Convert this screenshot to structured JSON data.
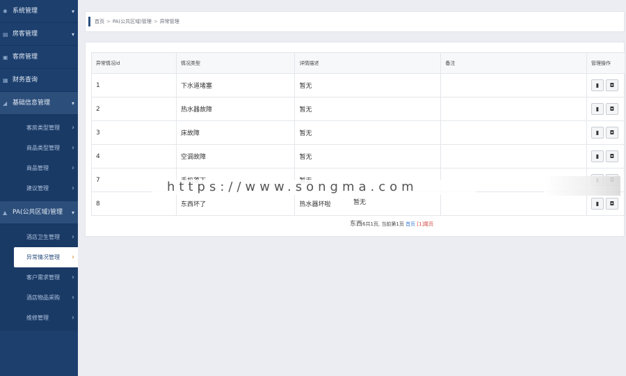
{
  "sidebar": {
    "items": [
      {
        "label": "系统管理",
        "icon": "gear-icon",
        "open": false
      },
      {
        "label": "房客管理",
        "icon": "users-icon",
        "open": false
      },
      {
        "label": "客房管理",
        "icon": "bed-icon",
        "open": false
      },
      {
        "label": "财务查询",
        "icon": "money-icon",
        "open": false
      },
      {
        "label": "基础信息管理",
        "icon": "info-icon",
        "open": true
      }
    ],
    "basic_sub": [
      "客房类型管理",
      "商品类型管理",
      "商品管理",
      "建议管理"
    ],
    "pa_item": {
      "label": "PA(公共区域)管理",
      "icon": "area-icon"
    },
    "pa_sub": [
      "酒店卫生管理",
      "异常情况管理",
      "客户需求管理",
      "酒店物品采购",
      "维修管理"
    ],
    "active_sub": "异常情况管理"
  },
  "breadcrumb": [
    "首页",
    "PA(公共区域)管理",
    "异常管理"
  ],
  "table": {
    "headers": [
      "异常情况id",
      "情况类型",
      "详情描述",
      "备注",
      "管理操作"
    ],
    "rows": [
      {
        "id": "1",
        "type": "下水道堵塞",
        "desc": "暂无",
        "note": ""
      },
      {
        "id": "2",
        "type": "热水器故障",
        "desc": "暂无",
        "note": ""
      },
      {
        "id": "3",
        "type": "床故障",
        "desc": "暂无",
        "note": ""
      },
      {
        "id": "4",
        "type": "空调故障",
        "desc": "暂无",
        "note": ""
      },
      {
        "id": "7",
        "type": "手机落下",
        "desc": "暂无",
        "note": ""
      },
      {
        "id": "8",
        "type": "东西坏了",
        "desc": "热水器坏啦",
        "note": ""
      }
    ],
    "row_ops": [
      "trash-icon",
      "bell-icon"
    ]
  },
  "pager": {
    "big": "东西",
    "summary": "6共1页, 当前第1页",
    "first": "首页",
    "current": "[1]",
    "last": "尾页"
  },
  "overlay": {
    "watermark": "https://www.songma.com",
    "floating_text": "暂无"
  }
}
